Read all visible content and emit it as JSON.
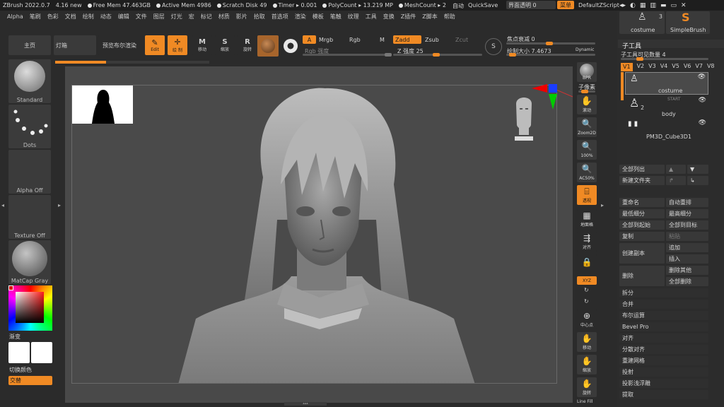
{
  "titlebar": {
    "app": "ZBrush 2022.0.7",
    "version": "4.16 new",
    "free_mem": "Free Mem 47.463GB",
    "active_mem": "Active Mem 4986",
    "scratch": "Scratch Disk 49",
    "timer": "Timer ▸ 0.001",
    "polycount": "PolyCount ▸ 13.219 MP",
    "meshcount": "MeshCount ▸ 2",
    "auto": "自动",
    "quicksave": "QuickSave",
    "transparency": "界面透明 0",
    "menu": "菜单",
    "script": "DefaultZScript"
  },
  "menu": [
    "Alpha",
    "笔刷",
    "色彩",
    "文档",
    "绘制",
    "动态",
    "编辑",
    "文件",
    "图层",
    "灯光",
    "宏",
    "标记",
    "材质",
    "影片",
    "拾取",
    "首选项",
    "渲染",
    "模板",
    "笔触",
    "纹理",
    "工具",
    "变换",
    "Z插件",
    "Z脚本",
    "帮助"
  ],
  "toolbar": {
    "home": "主页",
    "lightbox": "灯箱",
    "preview_bool": "预览布尔渲染",
    "edit": "Edit",
    "draw": "绘 制",
    "move": "移动",
    "scale": "缩放",
    "rotate": "旋转",
    "a": "A",
    "mrgb": "Mrgb",
    "rgb": "Rgb",
    "m": "M",
    "zadd": "Zadd",
    "zsub": "Zsub",
    "zcut": "Zcut",
    "rgb_intensity": "Rgb 强度",
    "z_intensity": "Z 强度 25",
    "focal_shift": "焦点衰减 0",
    "draw_size": "绘制大小 7.4673",
    "dynamic": "Dynamic"
  },
  "left_shelf": {
    "brush": "Standard",
    "stroke": "Dots",
    "alpha": "Alpha Off",
    "texture": "Texture Off",
    "material": "MatCap Gray",
    "gradient": "渐变",
    "switch_color": "切换颜色",
    "alternate": "交替"
  },
  "dock": [
    "BPR",
    "子像素",
    "滚动",
    "Zoom2D",
    "100%",
    "AC50%",
    "透视",
    "地面格",
    "对齐",
    "",
    "XYZ",
    "",
    "",
    "中心点",
    "移动",
    "缩放",
    "旋转",
    "Line Fill"
  ],
  "right_tray": {
    "tool_top": "costume",
    "tool_count": "3",
    "brush_top": "SimpleBrush",
    "subtool_title": "子工具",
    "visible_count": "子工具可见数量 4",
    "versions": [
      "V1",
      "V2",
      "V3",
      "V4",
      "V5",
      "V6",
      "V7",
      "V8"
    ],
    "subtools": [
      "costume",
      "body",
      "PM3D_Cube3D1"
    ],
    "start": "START",
    "subtool_number": "2",
    "list_all": "全部列出",
    "new_folder": "新建文件夹",
    "buttons": [
      [
        "重命名",
        "自动重排"
      ],
      [
        "最低细分",
        "最高细分"
      ],
      [
        "全部到起始",
        "全部到目标"
      ],
      [
        "复制",
        "粘贴"
      ]
    ],
    "duplicate": "创建副本",
    "append": "追加",
    "insert": "插入",
    "delete": "删除",
    "delete_other": "删除其他",
    "delete_all": "全部删除",
    "sections": [
      "拆分",
      "合并",
      "布尔运算",
      "Bevel Pro",
      "对齐",
      "分散对齐",
      "重建网格",
      "投射",
      "投影浅浮雕",
      "提取"
    ]
  },
  "colors": {
    "accent": "#f08a24",
    "bg": "#2b2b2b",
    "canvas": "#4a4a4a"
  }
}
